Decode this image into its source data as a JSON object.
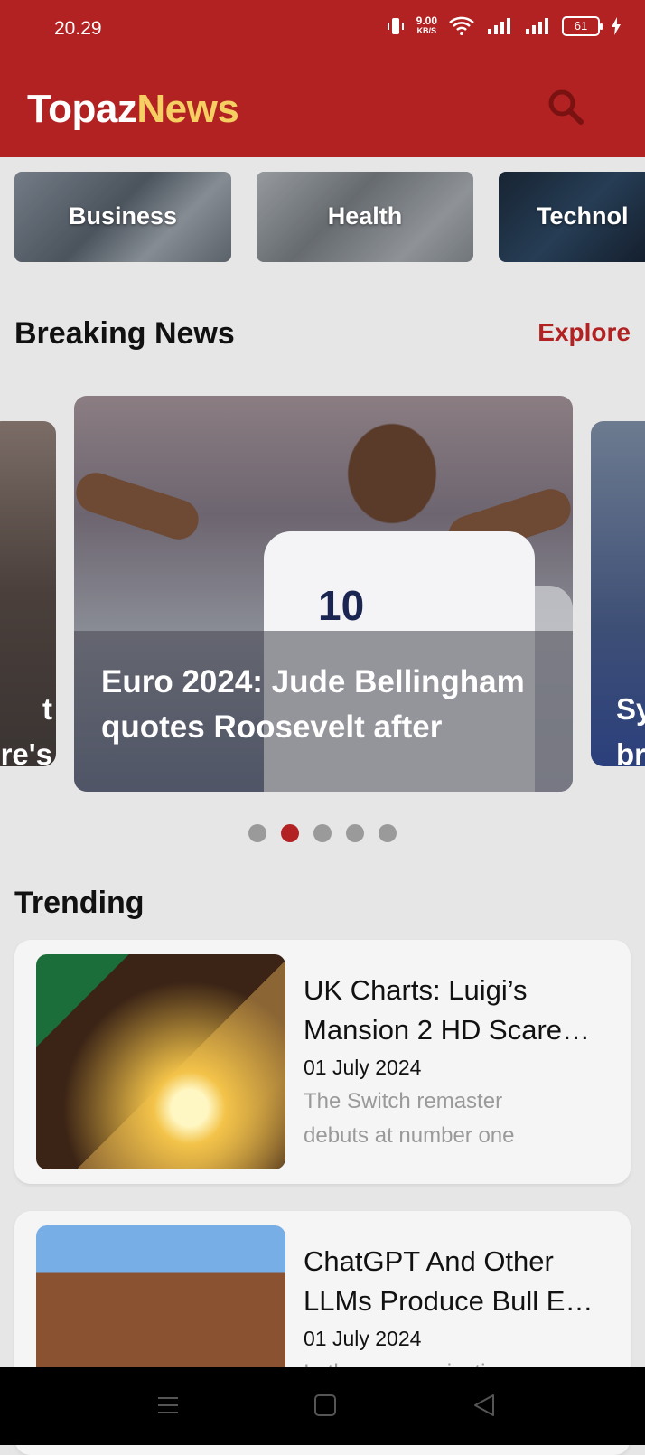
{
  "status_bar": {
    "time": "20.29",
    "net_speed_value": "9.00",
    "net_speed_unit": "KB/S",
    "battery": "61"
  },
  "header": {
    "brand_part1": "Topaz",
    "brand_part2": "News",
    "brand_color1": "#ffffff",
    "brand_color2": "#f6cf62",
    "background": "#b22222",
    "search_icon": "search-icon"
  },
  "categories": [
    {
      "label": "Business"
    },
    {
      "label": "Health"
    },
    {
      "label": "Technol"
    }
  ],
  "breaking": {
    "title": "Breaking News",
    "explore_label": "Explore",
    "slides": {
      "left_caption_line1": "t",
      "left_caption_line2": "re's",
      "main_caption_line1": "Euro 2024: Jude Bellingham",
      "main_caption_line2": "quotes Roosevelt after",
      "main_shirt_number": "10",
      "right_caption_line1": "Sy",
      "right_caption_line2": "br"
    },
    "active_dot": 2,
    "dot_count": 5
  },
  "trending": {
    "title": "Trending",
    "items": [
      {
        "title_line1": "UK Charts: Luigi’s",
        "title_line2": "Mansion 2 HD Scare…",
        "date": "01 July 2024",
        "desc_line1": "The Switch remaster",
        "desc_line2": "debuts at number one"
      },
      {
        "title_line1": "ChatGPT And Other",
        "title_line2": "LLMs Produce Bull E…",
        "date": "01 July 2024",
        "desc_line1": "In the communications",
        "desc_line2": ""
      }
    ]
  },
  "navbar": {
    "menu_icon": "menu-icon",
    "home_icon": "home-icon",
    "back_icon": "back-icon"
  }
}
